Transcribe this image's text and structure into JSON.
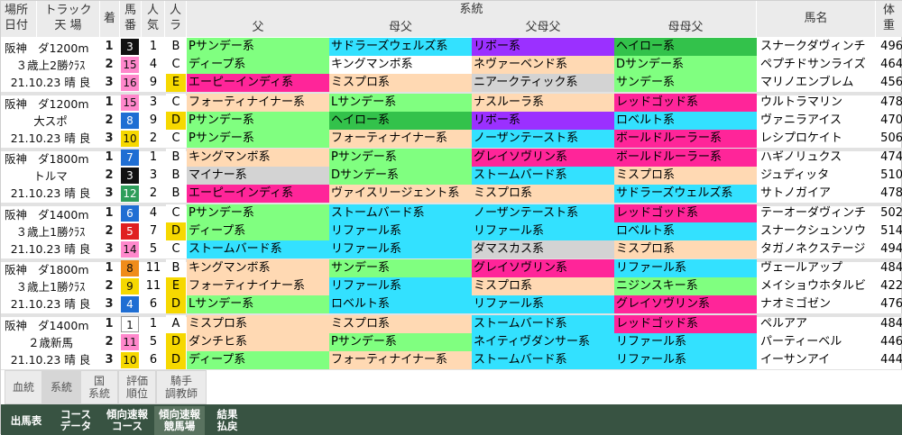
{
  "header": {
    "venue_date": [
      "場所",
      "日付"
    ],
    "track": [
      "トラック",
      "天 場"
    ],
    "rank": "着",
    "num": [
      "馬",
      "番"
    ],
    "pop": [
      "人",
      "気"
    ],
    "la": [
      "人",
      "ラ"
    ],
    "lineage": "系統",
    "sire": "父",
    "dam_sire": "母父",
    "sire_dam_sire": "父母父",
    "dam_dam_sire": "母母父",
    "horse": "馬名",
    "weight": [
      "体",
      "重"
    ]
  },
  "colors": {
    "P": "#80ff80",
    "S": "#ffd9b3",
    "F": "#ffd9b3",
    "R": "#33e1ff",
    "M": "#ffd9b3",
    "D": "#80ff80",
    "K": "#ffd9b3",
    "E": "#ff2599",
    "N": "#33e1ff",
    "H": "#33c24b",
    "Y": "#ffd9b3",
    "G": "#ff2599",
    "T": "#33e1ff",
    "X": "#d9d9d9",
    "W": "#ff2599",
    "NB": "#8f2eff",
    "L": "#80ff80",
    "A": "#33e1ff",
    "B": "#d9d9d9",
    "DM": "#d9d9d9"
  },
  "races": [
    {
      "venue": "阪神",
      "track": "ダ1200m",
      "cls": "３歳上2勝ｸﾗｽ",
      "date": "21.10.23 晴 良",
      "rows": [
        {
          "rank": "1",
          "num": "3",
          "numbg": "#111",
          "numfg": "#fff",
          "pop": "1",
          "ra": "B",
          "rabg": "#fff",
          "c": [
            [
              "Pサンデー系",
              "#80ff80"
            ],
            [
              "サドラーズウェルズ系",
              "#33e1ff"
            ],
            [
              "リボー系",
              "#9b30ff"
            ],
            [
              "ヘイロー系",
              "#33c24b"
            ]
          ],
          "horse": "スナークダヴィンチ",
          "wt": "496"
        },
        {
          "rank": "2",
          "num": "15",
          "numbg": "#ff88cc",
          "numfg": "#111",
          "pop": "4",
          "ra": "C",
          "rabg": "#fff",
          "c": [
            [
              "ディープ系",
              "#80ff80"
            ],
            [
              "キングマンボ系",
              "#ffffff"
            ],
            [
              "ネヴァーベンド系",
              "#ffd9b3"
            ],
            [
              "Dサンデー系",
              "#80ff80"
            ]
          ],
          "horse": "ペプチドサンライズ",
          "wt": "464"
        },
        {
          "rank": "3",
          "num": "16",
          "numbg": "#ff88cc",
          "numfg": "#111",
          "pop": "9",
          "ra": "E",
          "rabg": "#f6d800",
          "c": [
            [
              "エーピーインディ系",
              "#ff2599"
            ],
            [
              "ミスプロ系",
              "#ffd9b3"
            ],
            [
              "ニアークティック系",
              "#d3d3d3"
            ],
            [
              "サンデー系",
              "#80ff80"
            ]
          ],
          "horse": "マリノエンブレム",
          "wt": "456"
        }
      ]
    },
    {
      "venue": "阪神",
      "track": "ダ1200m",
      "cls": "大スポ",
      "date": "21.10.23 晴 良",
      "rows": [
        {
          "rank": "1",
          "num": "15",
          "numbg": "#ff88cc",
          "numfg": "#111",
          "pop": "3",
          "ra": "C",
          "rabg": "#fff",
          "c": [
            [
              "フォーティナイナー系",
              "#ffd9b3"
            ],
            [
              "Lサンデー系",
              "#80ff80"
            ],
            [
              "ナスルーラ系",
              "#ffd9b3"
            ],
            [
              "レッドゴッド系",
              "#ff2599"
            ]
          ],
          "horse": "ウルトラマリン",
          "wt": "478"
        },
        {
          "rank": "2",
          "num": "8",
          "numbg": "#1f6ed3",
          "numfg": "#fff",
          "pop": "9",
          "ra": "D",
          "rabg": "#f6d800",
          "c": [
            [
              "Pサンデー系",
              "#80ff80"
            ],
            [
              "ヘイロー系",
              "#33c24b"
            ],
            [
              "リボー系",
              "#9b30ff"
            ],
            [
              "ロベルト系",
              "#33e1ff"
            ]
          ],
          "horse": "ヴァニラアイス",
          "wt": "470"
        },
        {
          "rank": "3",
          "num": "10",
          "numbg": "#f6d800",
          "numfg": "#111",
          "pop": "2",
          "ra": "C",
          "rabg": "#fff",
          "c": [
            [
              "Pサンデー系",
              "#80ff80"
            ],
            [
              "フォーティナイナー系",
              "#ffd9b3"
            ],
            [
              "ノーザンテースト系",
              "#33e1ff"
            ],
            [
              "ボールドルーラー系",
              "#ff2599"
            ]
          ],
          "horse": "レシプロケイト",
          "wt": "506"
        }
      ]
    },
    {
      "venue": "阪神",
      "track": "ダ1800m",
      "cls": "トルマ",
      "date": "21.10.23 晴 良",
      "rows": [
        {
          "rank": "1",
          "num": "7",
          "numbg": "#1f6ed3",
          "numfg": "#fff",
          "pop": "1",
          "ra": "B",
          "rabg": "#fff",
          "c": [
            [
              "キングマンボ系",
              "#ffd9b3"
            ],
            [
              "Pサンデー系",
              "#80ff80"
            ],
            [
              "グレイソヴリン系",
              "#ff2599"
            ],
            [
              "ボールドルーラー系",
              "#ff2599"
            ]
          ],
          "horse": "ハギノリュクス",
          "wt": "474"
        },
        {
          "rank": "2",
          "num": "3",
          "numbg": "#111",
          "numfg": "#fff",
          "pop": "3",
          "ra": "B",
          "rabg": "#fff",
          "c": [
            [
              "マイナー系",
              "#d3d3d3"
            ],
            [
              "Dサンデー系",
              "#80ff80"
            ],
            [
              "ストームバード系",
              "#33e1ff"
            ],
            [
              "ミスプロ系",
              "#ffd9b3"
            ]
          ],
          "horse": "ジュディッタ",
          "wt": "510"
        },
        {
          "rank": "3",
          "num": "12",
          "numbg": "#2e9e5b",
          "numfg": "#fff",
          "pop": "2",
          "ra": "B",
          "rabg": "#fff",
          "c": [
            [
              "エーピーインディ系",
              "#ff2599"
            ],
            [
              "ヴァイスリージェント系",
              "#ffd9b3"
            ],
            [
              "ミスプロ系",
              "#ffd9b3"
            ],
            [
              "サドラーズウェルズ系",
              "#33e1ff"
            ]
          ],
          "horse": "サトノガイア",
          "wt": "478"
        }
      ]
    },
    {
      "venue": "阪神",
      "track": "ダ1400m",
      "cls": "３歳上1勝ｸﾗｽ",
      "date": "21.10.23 晴 良",
      "rows": [
        {
          "rank": "1",
          "num": "6",
          "numbg": "#1f6ed3",
          "numfg": "#fff",
          "pop": "4",
          "ra": "C",
          "rabg": "#fff",
          "c": [
            [
              "Pサンデー系",
              "#80ff80"
            ],
            [
              "ストームバード系",
              "#33e1ff"
            ],
            [
              "ノーザンテースト系",
              "#33e1ff"
            ],
            [
              "レッドゴッド系",
              "#ff2599"
            ]
          ],
          "horse": "テーオーダヴィンチ",
          "wt": "502"
        },
        {
          "rank": "2",
          "num": "5",
          "numbg": "#e02020",
          "numfg": "#fff",
          "pop": "7",
          "ra": "D",
          "rabg": "#f6d800",
          "c": [
            [
              "ディープ系",
              "#80ff80"
            ],
            [
              "リファール系",
              "#33e1ff"
            ],
            [
              "リファール系",
              "#33e1ff"
            ],
            [
              "ロベルト系",
              "#33e1ff"
            ]
          ],
          "horse": "スナークシュンソウ",
          "wt": "514"
        },
        {
          "rank": "3",
          "num": "14",
          "numbg": "#ff88cc",
          "numfg": "#111",
          "pop": "5",
          "ra": "C",
          "rabg": "#fff",
          "c": [
            [
              "ストームバード系",
              "#33e1ff"
            ],
            [
              "リファール系",
              "#33e1ff"
            ],
            [
              "ダマスカス系",
              "#d3d3d3"
            ],
            [
              "ミスプロ系",
              "#ffd9b3"
            ]
          ],
          "horse": "タガノネクステージ",
          "wt": "494"
        }
      ]
    },
    {
      "venue": "阪神",
      "track": "ダ1800m",
      "cls": "３歳上1勝ｸﾗｽ",
      "date": "21.10.23 晴 良",
      "rows": [
        {
          "rank": "1",
          "num": "8",
          "numbg": "#f08c1a",
          "numfg": "#111",
          "pop": "11",
          "ra": "B",
          "rabg": "#fff",
          "c": [
            [
              "キングマンボ系",
              "#ffd9b3"
            ],
            [
              "サンデー系",
              "#80ff80"
            ],
            [
              "グレイソヴリン系",
              "#ff2599"
            ],
            [
              "リファール系",
              "#33e1ff"
            ]
          ],
          "horse": "ヴェールアップ",
          "wt": "484"
        },
        {
          "rank": "2",
          "num": "9",
          "numbg": "#f6d800",
          "numfg": "#111",
          "pop": "11",
          "ra": "E",
          "rabg": "#f6d800",
          "c": [
            [
              "フォーティナイナー系",
              "#ffd9b3"
            ],
            [
              "リファール系",
              "#33e1ff"
            ],
            [
              "ミスプロ系",
              "#ffd9b3"
            ],
            [
              "ニジンスキー系",
              "#80ff80"
            ]
          ],
          "horse": "メイショウホタルビ",
          "wt": "422"
        },
        {
          "rank": "3",
          "num": "4",
          "numbg": "#1f6ed3",
          "numfg": "#fff",
          "pop": "6",
          "ra": "D",
          "rabg": "#f6d800",
          "c": [
            [
              "Lサンデー系",
              "#80ff80"
            ],
            [
              "ロベルト系",
              "#33e1ff"
            ],
            [
              "リファール系",
              "#33e1ff"
            ],
            [
              "グレイソヴリン系",
              "#ff2599"
            ]
          ],
          "horse": "ナオミゴゼン",
          "wt": "476"
        }
      ]
    },
    {
      "venue": "阪神",
      "track": "ダ1400m",
      "cls": "２歳新馬",
      "date": "21.10.23 晴 良",
      "rows": [
        {
          "rank": "1",
          "num": "1",
          "numbg": "#ffffff",
          "numfg": "#111",
          "pop": "1",
          "ra": "A",
          "rabg": "#fff",
          "c": [
            [
              "ミスプロ系",
              "#ffd9b3"
            ],
            [
              "ミスプロ系",
              "#ffd9b3"
            ],
            [
              "ストームバード系",
              "#33e1ff"
            ],
            [
              "レッドゴッド系",
              "#ff2599"
            ]
          ],
          "horse": "ペルアア",
          "wt": "484"
        },
        {
          "rank": "2",
          "num": "11",
          "numbg": "#ff88cc",
          "numfg": "#111",
          "pop": "5",
          "ra": "D",
          "rabg": "#f6d800",
          "c": [
            [
              "ダンチヒ系",
              "#ffd9b3"
            ],
            [
              "Pサンデー系",
              "#80ff80"
            ],
            [
              "ネイティヴダンサー系",
              "#33e1ff"
            ],
            [
              "リファール系",
              "#33e1ff"
            ]
          ],
          "horse": "パーティーベル",
          "wt": "446"
        },
        {
          "rank": "3",
          "num": "10",
          "numbg": "#f6d800",
          "numfg": "#111",
          "pop": "6",
          "ra": "D",
          "rabg": "#f6d800",
          "c": [
            [
              "ディープ系",
              "#80ff80"
            ],
            [
              "フォーティナイナー系",
              "#ffd9b3"
            ],
            [
              "ストームバード系",
              "#33e1ff"
            ],
            [
              "リファール系",
              "#33e1ff"
            ]
          ],
          "horse": "イーサンアイ",
          "wt": "444"
        }
      ]
    }
  ],
  "tabs_top": [
    [
      "血統",
      ""
    ],
    [
      "系統",
      ""
    ],
    [
      "国",
      "系統"
    ],
    [
      "評価",
      "順位"
    ],
    [
      "騎手",
      "調教師"
    ]
  ],
  "tabs_bottom": [
    [
      "出馬表",
      ""
    ],
    [
      "コース",
      "データ"
    ],
    [
      "傾向速報",
      "コース"
    ],
    [
      "傾向速報",
      "競馬場"
    ],
    [
      "結果",
      "払戻"
    ]
  ]
}
